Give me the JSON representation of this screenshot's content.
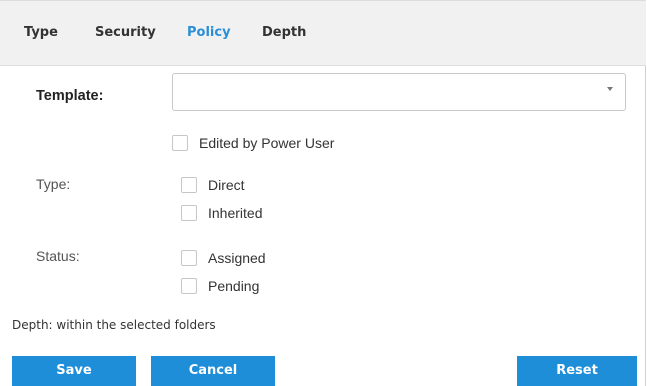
{
  "tabs": [
    {
      "label": "Type",
      "active": false
    },
    {
      "label": "Security",
      "active": false
    },
    {
      "label": "Policy",
      "active": true
    },
    {
      "label": "Depth",
      "active": false
    }
  ],
  "template": {
    "label": "Template:",
    "value": ""
  },
  "edited_by_power_user": {
    "label": "Edited by Power User",
    "checked": false
  },
  "type_group": {
    "label": "Type:",
    "options": [
      {
        "label": "Direct",
        "checked": false
      },
      {
        "label": "Inherited",
        "checked": false
      }
    ]
  },
  "status_group": {
    "label": "Status:",
    "options": [
      {
        "label": "Assigned",
        "checked": false
      },
      {
        "label": "Pending",
        "checked": false
      }
    ]
  },
  "depth_note": "Depth: within the selected folders",
  "buttons": {
    "save": "Save",
    "cancel": "Cancel",
    "reset": "Reset"
  },
  "colors": {
    "accent": "#1f8ed9",
    "active_tab": "#2a8fd6",
    "tab_bar": "#f1f1f1"
  }
}
